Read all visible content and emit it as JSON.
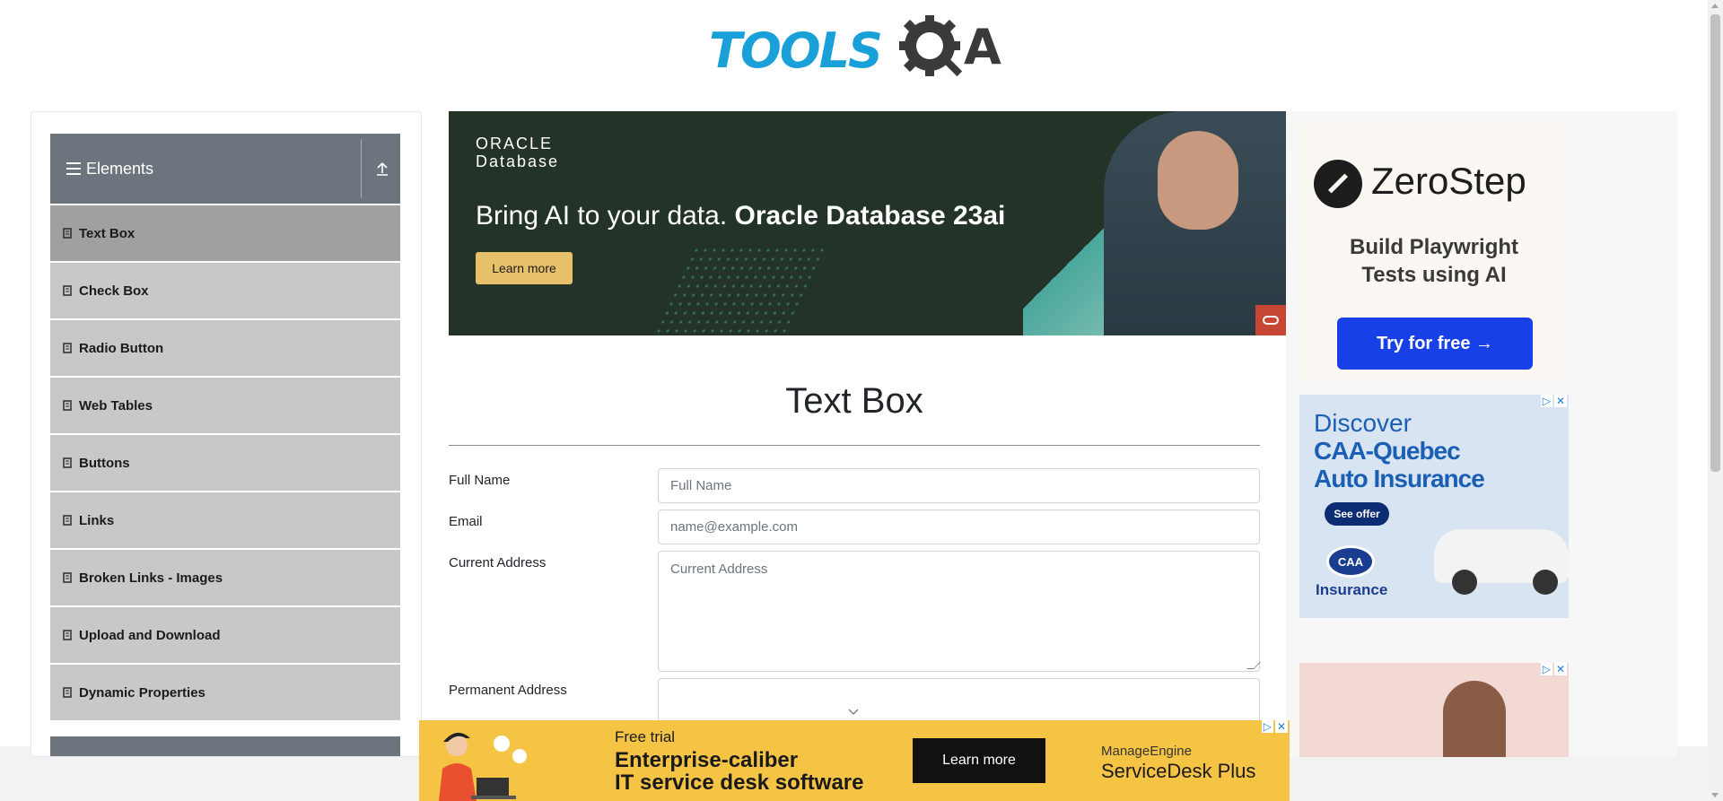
{
  "header": {
    "logo_text": "TOOLS",
    "logo_suffix": "A"
  },
  "sidebar": {
    "group_title": "Elements",
    "items": [
      {
        "label": "Text Box",
        "active": true
      },
      {
        "label": "Check Box"
      },
      {
        "label": "Radio Button"
      },
      {
        "label": "Web Tables"
      },
      {
        "label": "Buttons"
      },
      {
        "label": "Links"
      },
      {
        "label": "Broken Links - Images"
      },
      {
        "label": "Upload and Download"
      },
      {
        "label": "Dynamic Properties"
      }
    ]
  },
  "ad_top": {
    "brand_line1": "ORACLE",
    "brand_line2": "Database",
    "headline_plain": "Bring AI to your data. ",
    "headline_bold": "Oracle Database 23ai",
    "cta": "Learn more"
  },
  "form": {
    "title": "Text Box",
    "full_name_label": "Full Name",
    "full_name_placeholder": "Full Name",
    "email_label": "Email",
    "email_placeholder": "name@example.com",
    "current_address_label": "Current Address",
    "current_address_placeholder": "Current Address",
    "permanent_address_label": "Permanent Address"
  },
  "ad_zerostep": {
    "name": "ZeroStep",
    "subtitle_line1": "Build Playwright",
    "subtitle_line2": "Tests using AI",
    "cta": "Try for free →"
  },
  "ad_caa": {
    "line1": "Discover",
    "line2": "CAA-Quebec",
    "line3": "Auto Insurance",
    "cta": "See offer",
    "logo": "CAA",
    "logo_sub": "Insurance"
  },
  "ad_bottom": {
    "small": "Free trial",
    "line1": "Enterprise-caliber",
    "line2": "IT service desk software",
    "cta": "Learn more",
    "brand1": "ManageEngine",
    "brand2": "ServiceDesk Plus"
  },
  "colors": {
    "accent_blue": "#1aa0d8",
    "sidebar_header": "#6c757d",
    "menu_item": "#c8c8c8",
    "menu_item_active": "#a0a0a0",
    "oracle_bg": "#233327",
    "zerostep_button": "#1741e6",
    "bottom_ad_bg": "#f6c445"
  }
}
